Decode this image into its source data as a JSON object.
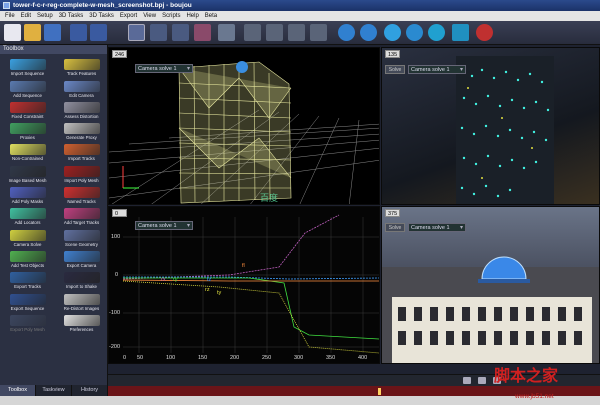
{
  "window": {
    "title": "tower-f-c-r-reg-complete-w-mesh_screenshot.bpj - boujou"
  },
  "menu": [
    "File",
    "Edit",
    "Setup",
    "3D Tasks",
    "3D Tasks",
    "Export",
    "View",
    "Scripts",
    "Help",
    "Beta"
  ],
  "sidebar": {
    "header": "Toolbox",
    "tools": [
      {
        "label": "Import Sequence",
        "color": "#3aa0e0",
        "enabled": true
      },
      {
        "label": "Track Features",
        "color": "#d8c040",
        "enabled": true
      },
      {
        "label": "Add Sequence",
        "color": "#5a7ab0",
        "enabled": true
      },
      {
        "label": "Edit Camera",
        "color": "#6a88c8",
        "enabled": true
      },
      {
        "label": "Fixed Constraint",
        "color": "#c03030",
        "enabled": true
      },
      {
        "label": "Assess Distortion",
        "color": "#9090a0",
        "enabled": true
      },
      {
        "label": "Proxies",
        "color": "#40a060",
        "enabled": true
      },
      {
        "label": "Generate Proxy",
        "color": "#c0c0c0",
        "enabled": true
      },
      {
        "label": "Non-Contrained",
        "color": "#e0e060",
        "enabled": true
      },
      {
        "label": "Import Tracks",
        "color": "#d06030",
        "enabled": true
      },
      {
        "label": "Image Based Mesh",
        "color": "#303848",
        "enabled": true
      },
      {
        "label": "Import Poly Mesh",
        "color": "#a02020",
        "enabled": true
      },
      {
        "label": "Add Poly Masks",
        "color": "#5060c0",
        "enabled": true
      },
      {
        "label": "Named Tracks",
        "color": "#d03030",
        "enabled": true
      },
      {
        "label": "Add Locators",
        "color": "#40c0a0",
        "enabled": true
      },
      {
        "label": "Add Target Tracks",
        "color": "#c04080",
        "enabled": true
      },
      {
        "label": "Camera Solve",
        "color": "#d0d040",
        "enabled": true
      },
      {
        "label": "Scene Geometry",
        "color": "#6070a0",
        "enabled": true
      },
      {
        "label": "Add Test Objects",
        "color": "#50b050",
        "enabled": true
      },
      {
        "label": "Export Camera",
        "color": "#4080d0",
        "enabled": true
      },
      {
        "label": "Export Tracks",
        "color": "#3060a0",
        "enabled": true
      },
      {
        "label": "Import to Shake",
        "color": "#2a2a40",
        "enabled": true
      },
      {
        "label": "Export Sequence",
        "color": "#305090",
        "enabled": true
      },
      {
        "label": "Re-Distort Images",
        "color": "#c0c0c0",
        "enabled": true
      },
      {
        "label": "Export Poly Mesh",
        "color": "#506080",
        "enabled": false
      },
      {
        "label": "Preferences",
        "color": "#e0e0e0",
        "enabled": true
      }
    ],
    "tabs": [
      "Toolbox",
      "Taskview",
      "History"
    ]
  },
  "viewports": {
    "top_left": {
      "frame": "246",
      "camera": "Camera solve 1"
    },
    "top_right": {
      "frame": "135",
      "camera": "Camera solve 1",
      "button": "Solve"
    },
    "bottom_left": {
      "frame": "0",
      "camera": "Camera solve 1",
      "y_ticks": [
        "100",
        "0",
        "-100",
        "-200"
      ],
      "x_ticks": [
        "0",
        "50",
        "100",
        "150",
        "200",
        "250",
        "300",
        "350",
        "400"
      ],
      "curve_labels": [
        "fl",
        "rx",
        "ry",
        "tz",
        "rz",
        "ty"
      ]
    },
    "bottom_right": {
      "frame": "375",
      "camera": "Camera solve 1",
      "button": "Solve"
    }
  },
  "watermark": {
    "site": "脚本之家",
    "url": "www.jb51.net",
    "center": "百度"
  }
}
